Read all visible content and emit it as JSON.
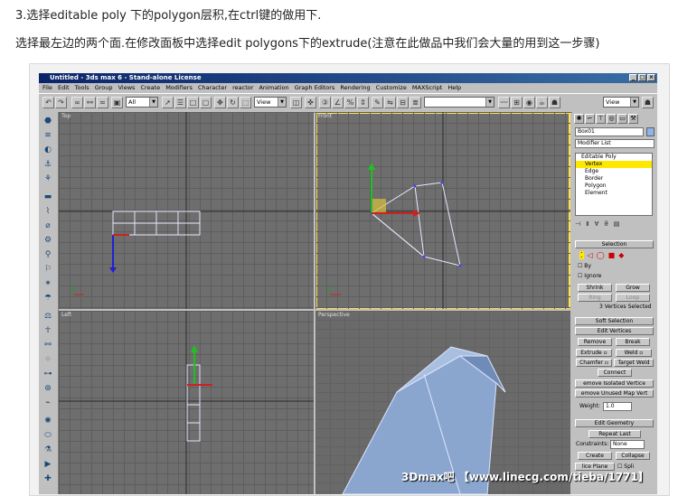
{
  "instructions": {
    "step": "3.选择editable poly 下的polygon层积,在ctrl键的做用下.",
    "detail": "选择最左边的两个面.在修改面板中选择edit polygons下的extrude(注意在此做品中我们会大量的用到这一步骤)"
  },
  "app": {
    "title": "Untitled - 3ds max 6 - Stand-alone License",
    "menu": [
      "File",
      "Edit",
      "Tools",
      "Group",
      "Views",
      "Create",
      "Modifiers",
      "Character",
      "reactor",
      "Animation",
      "Graph Editors",
      "Rendering",
      "Customize",
      "MAXScript",
      "Help"
    ],
    "toolbar": {
      "selection_filter": "All",
      "ref_coord": "View",
      "named_selection": "",
      "view_combo": "View"
    },
    "viewports": {
      "top": "Top",
      "front": "Front",
      "left": "Left",
      "perspective": "Perspective"
    },
    "command_panel": {
      "object_name": "Box01",
      "modifier_list": "Modifier List",
      "stack": {
        "root": "Editable Poly",
        "items": [
          "Vertex",
          "Edge",
          "Border",
          "Polygon",
          "Element"
        ]
      },
      "selection": {
        "header": "Selection",
        "by": "By",
        "ignore": "Ignore",
        "shrink": "Shrink",
        "grow": "Grow",
        "ring": "Ring",
        "loop": "Loop",
        "status": "3 Vertices Selected"
      },
      "soft_selection": "Soft Selection",
      "edit_vertices": {
        "header": "Edit Vertices",
        "remove": "Remove",
        "break": "Break",
        "extrude": "Extrude",
        "weld": "Weld",
        "chamfer": "Chamfer",
        "target_weld": "Target Weld",
        "connect": "Connect",
        "remove_isolated": "emove Isolated Vertice",
        "remove_unused": "emove Unused Map Vert",
        "weight_label": "Weight:",
        "weight_value": "1.0"
      },
      "edit_geometry": {
        "header": "Edit Geometry",
        "repeat_last": "Repeat Last",
        "constraints_label": "Constraints:",
        "constraints_value": "None",
        "create": "Create",
        "collapse": "Collapse",
        "slice_plane": "lice Plane",
        "split": "Spli"
      }
    }
  },
  "watermark": "3Dmax吧 【www.linecg.com/tieba/1771】",
  "colors": {
    "viewport_bg": "#6e6e6e",
    "active_border": "#ffe14a",
    "selection_highlight": "#ffe800",
    "mesh": "#e8e8ff",
    "persp_mesh": "#8aa6cf"
  }
}
